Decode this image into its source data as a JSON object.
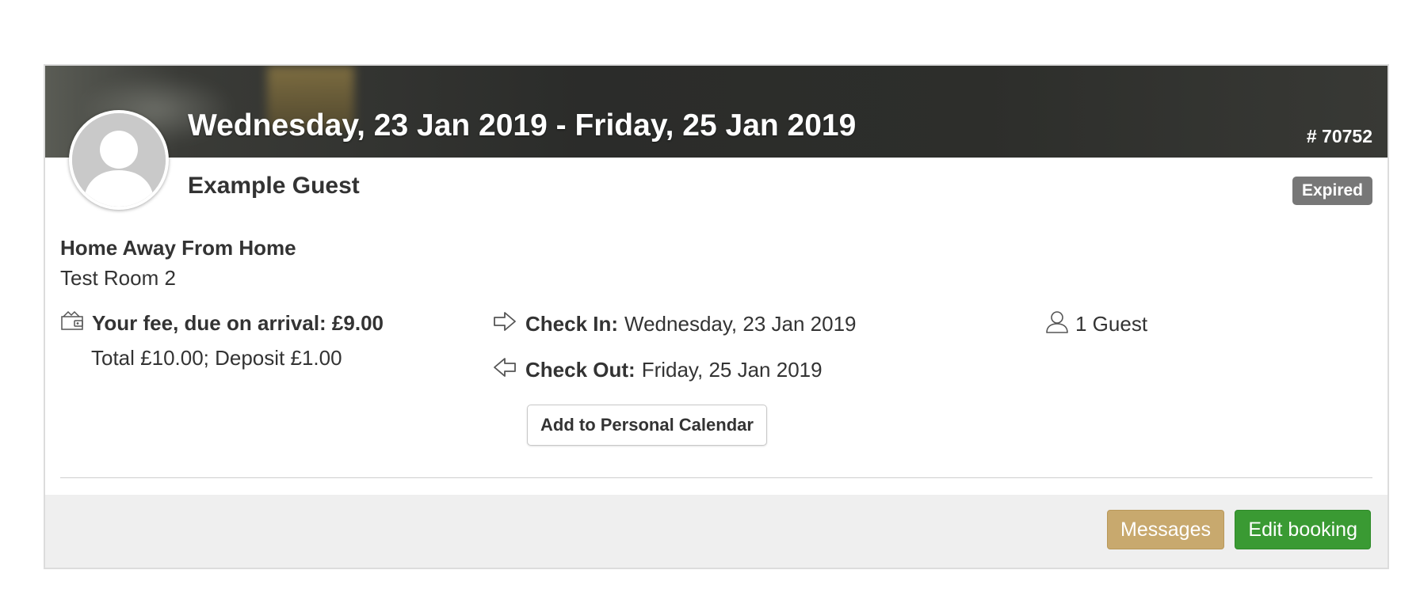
{
  "booking": {
    "date_range": "Wednesday, 23 Jan 2019 - Friday, 25 Jan 2019",
    "id": "# 70752",
    "guest_name": "Example Guest",
    "status": "Expired",
    "property": "Home Away From Home",
    "room": "Test Room 2"
  },
  "fee": {
    "label": "Your fee, due on arrival: £9.00",
    "breakdown": "Total £10.00; Deposit £1.00",
    "icon": "wallet-icon"
  },
  "checkin": {
    "label": "Check In:",
    "value": "Wednesday, 23 Jan 2019",
    "icon": "arrow-right-icon"
  },
  "checkout": {
    "label": "Check Out:",
    "value": "Friday, 25 Jan 2019",
    "icon": "arrow-left-icon"
  },
  "guests": {
    "count_label": "1 Guest",
    "icon": "user-icon"
  },
  "actions": {
    "calendar_label": "Add to Personal Calendar",
    "messages_label": "Messages",
    "edit_label": "Edit booking"
  },
  "colors": {
    "badge": "#777777",
    "messages_button": "#c8a96e",
    "edit_button": "#3a9a33"
  }
}
